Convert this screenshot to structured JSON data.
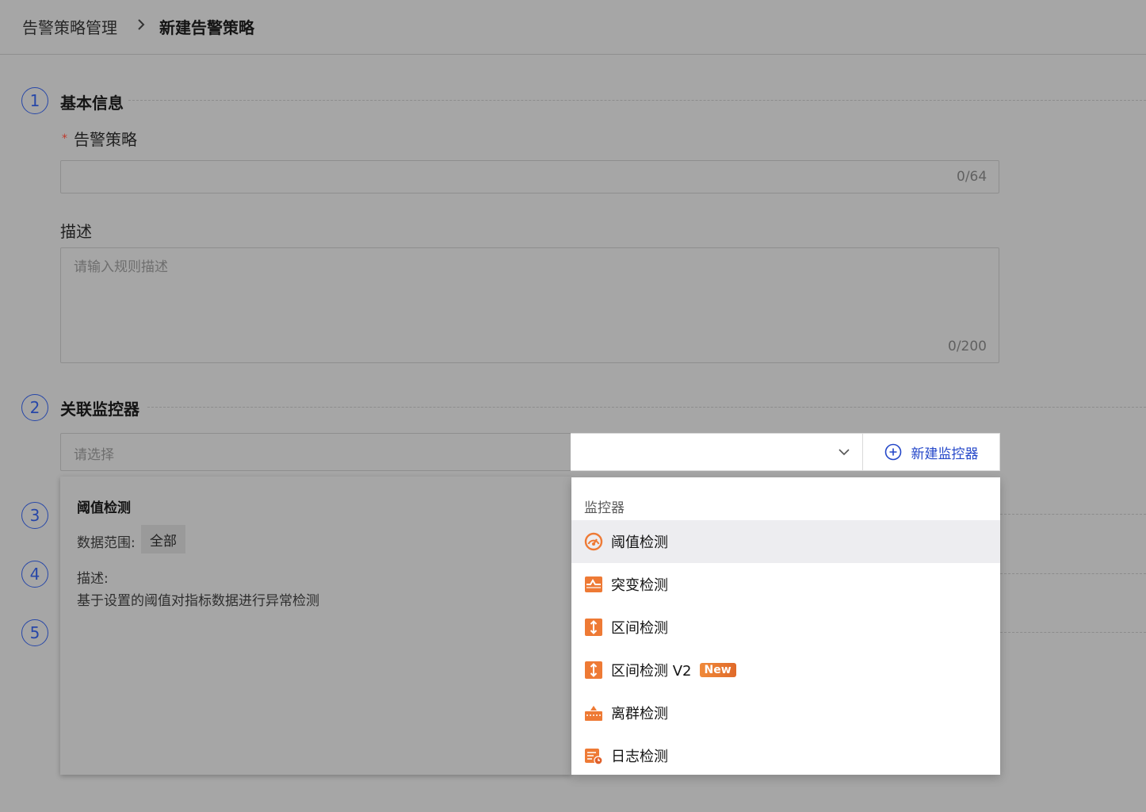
{
  "breadcrumb": {
    "parent": "告警策略管理",
    "current": "新建告警策略"
  },
  "steps": [
    {
      "number": "1",
      "title": "基本信息"
    },
    {
      "number": "2",
      "title": "关联监控器"
    },
    {
      "number": "3",
      "title": ""
    },
    {
      "number": "4",
      "title": ""
    },
    {
      "number": "5",
      "title": ""
    }
  ],
  "basic": {
    "policy_label": "告警策略",
    "required_mark": "*",
    "policy_value": "",
    "policy_counter": "0/64",
    "desc_label": "描述",
    "desc_placeholder": "请输入规则描述",
    "desc_counter": "0/200"
  },
  "monitor": {
    "select_placeholder": "请选择",
    "new_button_label": "新建监控器",
    "chevron_icon": "chevron-down-icon",
    "plus_icon": "plus-circle-icon"
  },
  "info_panel": {
    "title": "阈值检测",
    "range_label": "数据范围:",
    "range_value": "全部",
    "desc_label": "描述:",
    "desc_text": "基于设置的阈值对指标数据进行异常检测"
  },
  "dropdown": {
    "group_label": "监控器",
    "items": [
      {
        "label": "阈值检测",
        "icon": "threshold-icon",
        "active": true
      },
      {
        "label": "突变检测",
        "icon": "mutation-icon"
      },
      {
        "label": "区间检测",
        "icon": "interval-icon"
      },
      {
        "label": "区间检测 V2",
        "icon": "interval-v2-icon",
        "badge": "New"
      },
      {
        "label": "离群检测",
        "icon": "outlier-icon"
      },
      {
        "label": "日志检测",
        "icon": "log-icon"
      }
    ]
  },
  "colors": {
    "accent": "#2447c9",
    "step": "#2747a8",
    "icon_orange": "#ee7a35",
    "overlay_bg": "#a6a6a6"
  }
}
